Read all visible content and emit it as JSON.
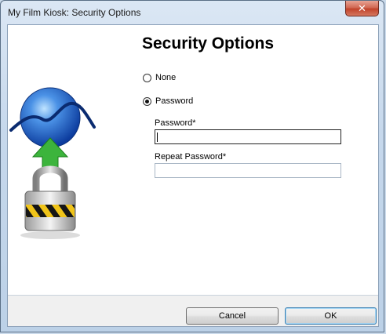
{
  "window": {
    "title": "My Film Kiosk: Security Options",
    "close_glyph": "✕"
  },
  "header": {
    "title": "Security Options"
  },
  "options": {
    "none_label": "None",
    "password_label": "Password",
    "selected": "Password"
  },
  "fields": {
    "password_label": "Password*",
    "password_value": "",
    "repeat_label": "Repeat Password*",
    "repeat_value": ""
  },
  "buttons": {
    "cancel_label": "Cancel",
    "ok_label": "OK"
  },
  "icons": {
    "graphic": "globe-lock-icon",
    "upload_arrow": "up-arrow-icon",
    "padlock": "padlock-icon"
  },
  "colors": {
    "globe": "#2f6fd0",
    "arrow": "#3cb43c",
    "stripe_yellow": "#f0c419",
    "close_red": "#c1432b"
  }
}
